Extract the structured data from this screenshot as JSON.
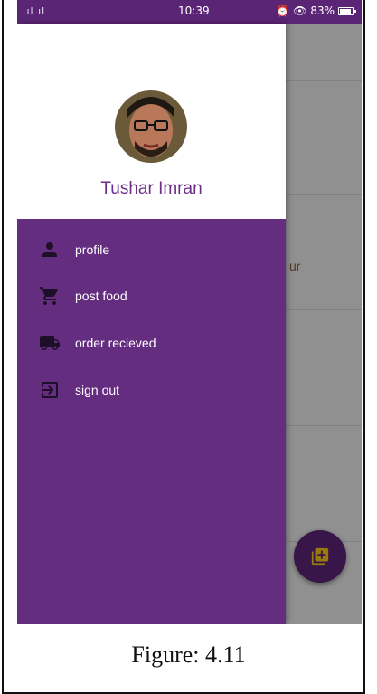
{
  "status_bar": {
    "signal": ".ıl ıl",
    "time": "10:39",
    "battery_percent": "83%"
  },
  "drawer": {
    "user_name": "Tushar Imran",
    "items": [
      {
        "label": "profile",
        "icon": "person-icon"
      },
      {
        "label": "post food",
        "icon": "cart-icon"
      },
      {
        "label": "order recieved",
        "icon": "truck-icon"
      },
      {
        "label": "sign out",
        "icon": "logout-icon"
      }
    ]
  },
  "background": {
    "partial_text": "ur"
  },
  "caption": "Figure: 4.11",
  "colors": {
    "primary": "#652d80",
    "status_bar": "#5b2576",
    "fab_icon": "#f5c518"
  }
}
